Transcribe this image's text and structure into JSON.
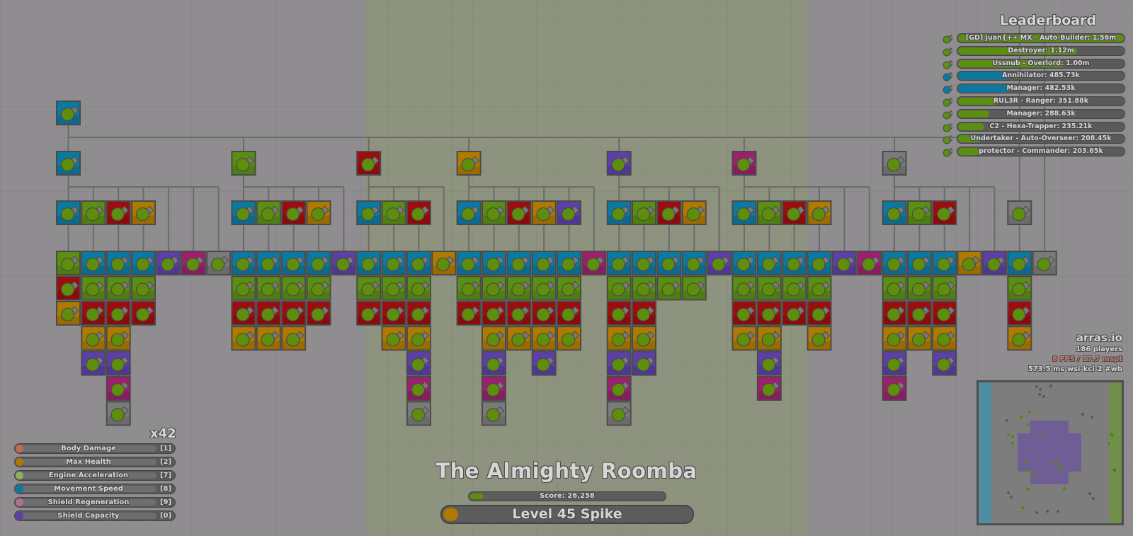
{
  "colors": {
    "blue": "#0b7aa3",
    "green": "#5a8f12",
    "red": "#9e0d0d",
    "orange": "#b07a00",
    "purple": "#5c3fa8",
    "pink": "#9e1f6e",
    "gray": "#7a7a7a",
    "tank_body": "#5e8e0c",
    "barrel": "#7a7a7a",
    "outline": "#4a4a4a",
    "line": "#6b6b6b"
  },
  "upgrade_tree": {
    "root": {
      "color": "blue",
      "shape": "basic"
    },
    "branches": [
      {
        "parent": {
          "color": "blue"
        },
        "columns": [
          {
            "attached": true,
            "cells": [
              "blue",
              "green",
              "red",
              "orange"
            ]
          },
          {
            "attached": true,
            "cells": [
              "green",
              "blue",
              "green",
              "red",
              "orange",
              "purple"
            ]
          },
          {
            "attached": true,
            "cells": [
              "red",
              "blue",
              "green",
              "red",
              "orange",
              "purple",
              "pink",
              "gray"
            ]
          },
          {
            "attached": true,
            "cells": [
              "orange",
              "blue",
              "green",
              "red"
            ]
          },
          {
            "attached": false,
            "cells": [
              "purple"
            ]
          },
          {
            "attached": false,
            "cells": [
              "pink"
            ]
          },
          {
            "attached": false,
            "cells": [
              "gray"
            ]
          }
        ]
      },
      {
        "parent": {
          "color": "green"
        },
        "columns": [
          {
            "attached": true,
            "cells": [
              "blue",
              "blue",
              "green",
              "red",
              "orange"
            ]
          },
          {
            "attached": true,
            "cells": [
              "green",
              "blue",
              "green",
              "red",
              "orange"
            ]
          },
          {
            "attached": true,
            "cells": [
              "red",
              "blue",
              "green",
              "red",
              "orange"
            ]
          },
          {
            "attached": true,
            "cells": [
              "orange",
              "blue",
              "green",
              "red"
            ]
          },
          {
            "attached": false,
            "cells": [
              "purple"
            ]
          }
        ]
      },
      {
        "parent": {
          "color": "red"
        },
        "columns": [
          {
            "attached": true,
            "cells": [
              "blue",
              "blue",
              "green",
              "red"
            ]
          },
          {
            "attached": true,
            "cells": [
              "green",
              "blue",
              "green",
              "red",
              "orange"
            ]
          },
          {
            "attached": true,
            "cells": [
              "red",
              "blue",
              "green",
              "red",
              "orange",
              "purple",
              "pink",
              "gray"
            ]
          },
          {
            "attached": false,
            "cells": [
              "orange"
            ]
          }
        ]
      },
      {
        "parent": {
          "color": "orange"
        },
        "columns": [
          {
            "attached": true,
            "cells": [
              "blue",
              "blue",
              "green",
              "red"
            ]
          },
          {
            "attached": true,
            "cells": [
              "green",
              "blue",
              "green",
              "red",
              "orange",
              "purple",
              "pink",
              "gray"
            ]
          },
          {
            "attached": true,
            "cells": [
              "red",
              "blue",
              "green",
              "red",
              "orange"
            ]
          },
          {
            "attached": true,
            "cells": [
              "orange",
              "blue",
              "green",
              "red",
              "orange",
              "purple"
            ]
          },
          {
            "attached": true,
            "cells": [
              "purple",
              "blue",
              "green",
              "red",
              "orange"
            ]
          },
          {
            "attached": false,
            "cells": [
              "pink"
            ]
          }
        ]
      },
      {
        "parent": {
          "color": "purple"
        },
        "columns": [
          {
            "attached": true,
            "cells": [
              "blue",
              "blue",
              "green",
              "red",
              "orange",
              "purple",
              "pink",
              "gray"
            ]
          },
          {
            "attached": true,
            "cells": [
              "green",
              "blue",
              "green",
              "red",
              "orange",
              "purple"
            ]
          },
          {
            "attached": true,
            "cells": [
              "red",
              "blue",
              "green"
            ]
          },
          {
            "attached": true,
            "cells": [
              "orange",
              "blue",
              "green"
            ]
          },
          {
            "attached": false,
            "cells": [
              "purple"
            ]
          }
        ]
      },
      {
        "parent": {
          "color": "pink"
        },
        "columns": [
          {
            "attached": true,
            "cells": [
              "blue",
              "blue",
              "green",
              "red",
              "orange"
            ]
          },
          {
            "attached": true,
            "cells": [
              "green",
              "blue",
              "green",
              "red",
              "orange",
              "purple",
              "pink"
            ]
          },
          {
            "attached": true,
            "cells": [
              "red",
              "blue",
              "green",
              "red"
            ]
          },
          {
            "attached": true,
            "cells": [
              "orange",
              "blue",
              "green",
              "red",
              "orange"
            ]
          },
          {
            "attached": false,
            "cells": [
              "purple"
            ]
          },
          {
            "attached": false,
            "cells": [
              "pink"
            ]
          }
        ]
      },
      {
        "parent": {
          "color": "gray"
        },
        "columns": [
          {
            "attached": true,
            "cells": [
              "blue",
              "blue",
              "green",
              "red",
              "orange",
              "purple",
              "pink"
            ]
          },
          {
            "attached": true,
            "cells": [
              "green",
              "blue",
              "green",
              "red",
              "orange"
            ]
          },
          {
            "attached": true,
            "cells": [
              "red",
              "blue",
              "green",
              "red",
              "orange",
              "purple"
            ]
          },
          {
            "attached": false,
            "cells": [
              "orange"
            ]
          },
          {
            "attached": false,
            "cells": [
              "purple"
            ]
          }
        ]
      },
      {
        "parent": null,
        "columns": [
          {
            "attached": true,
            "cells": [
              "gray",
              "blue",
              "green",
              "red",
              "orange"
            ]
          },
          {
            "attached": false,
            "cells": [
              "gray"
            ]
          }
        ]
      }
    ]
  },
  "leaderboard": {
    "title": "Leaderboard",
    "entries": [
      {
        "label": "[GD] juan{++ MX - Auto-Builder: 1.56m",
        "color": "green",
        "fill": 1.0,
        "icon": "auto-builder-icon"
      },
      {
        "label": "Destroyer: 1.12m",
        "color": "green",
        "fill": 0.72,
        "icon": "destroyer-icon"
      },
      {
        "label": "Ussnub - Overlord: 1.00m",
        "color": "green",
        "fill": 0.64,
        "icon": "overlord-icon"
      },
      {
        "label": "Annihilator: 485.73k",
        "color": "blue",
        "fill": 0.31,
        "icon": "annihilator-icon"
      },
      {
        "label": "Manager: 482.53k",
        "color": "blue",
        "fill": 0.31,
        "icon": "manager-icon"
      },
      {
        "label": "RUL3R - Ranger: 351.88k",
        "color": "green",
        "fill": 0.23,
        "icon": "ranger-icon"
      },
      {
        "label": "Manager: 288.63k",
        "color": "green",
        "fill": 0.19,
        "icon": "manager-icon"
      },
      {
        "label": "C2 - Hexa-Trapper: 235.21k",
        "color": "green",
        "fill": 0.16,
        "icon": "hexa-trapper-icon"
      },
      {
        "label": "Undertaker - Auto-Overseer: 208.45k",
        "color": "green",
        "fill": 0.14,
        "icon": "auto-overseer-icon"
      },
      {
        "label": "protector - Commander: 203.65k",
        "color": "green",
        "fill": 0.13,
        "icon": "commander-icon"
      }
    ]
  },
  "server_info": {
    "brand": "arras.io",
    "players": "186 players",
    "performance": "8 FPS / 17.7 mspt",
    "latency": "573.5 ms  wsi-kci-2 #wb"
  },
  "stats": {
    "points_available": "x42",
    "items": [
      {
        "label": "Body Damage",
        "level": "[1]",
        "color": "#c06a5a"
      },
      {
        "label": "Max Health",
        "level": "[2]",
        "color": "#b07a00"
      },
      {
        "label": "Engine Acceleration",
        "level": "[7]",
        "color": "#8fb060"
      },
      {
        "label": "Movement Speed",
        "level": "[8]",
        "color": "#0b7aa3"
      },
      {
        "label": "Shield Regeneration",
        "level": "[9]",
        "color": "#b0708f"
      },
      {
        "label": "Shield Capacity",
        "level": "[0]",
        "color": "#5c3fa8"
      }
    ]
  },
  "player": {
    "name": "The Almighty Roomba",
    "score_text": "Score: 26,258",
    "score_progress": 0.07,
    "level_text": "Level 45 Spike",
    "level_color": "#b07a00"
  }
}
